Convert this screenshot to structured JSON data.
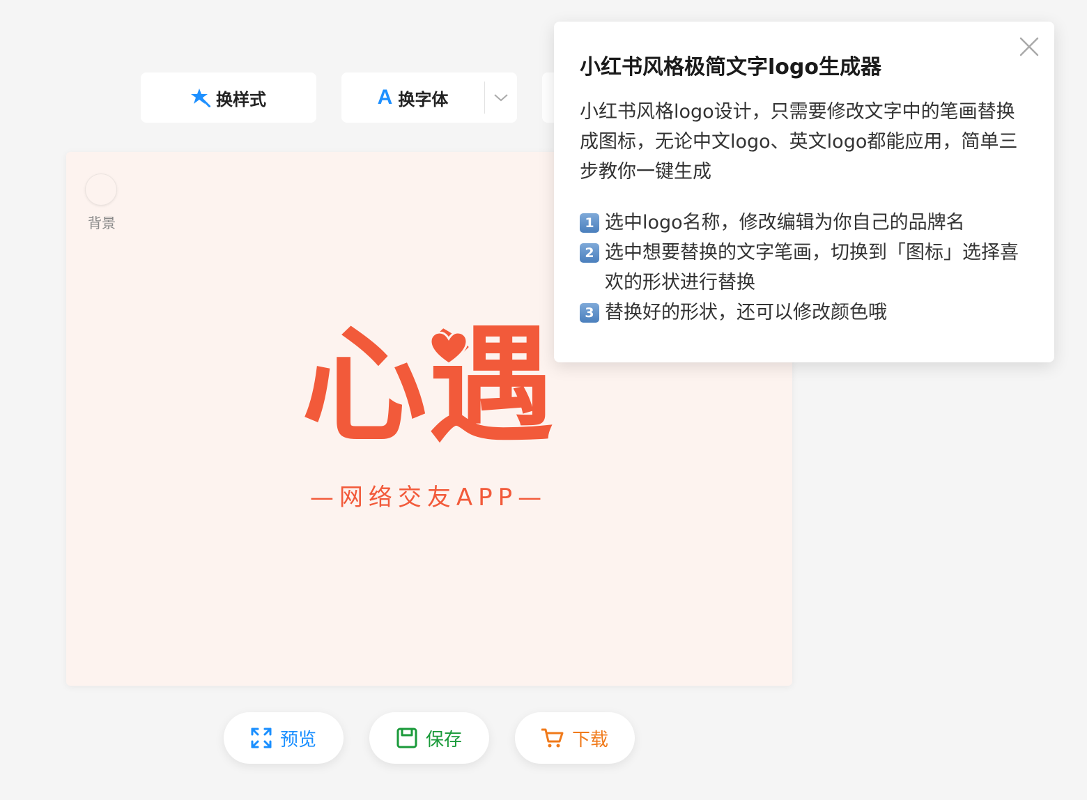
{
  "toolbar": {
    "change_style_label": "换样式",
    "change_font_letter": "A",
    "change_font_label": "换字体"
  },
  "canvas": {
    "background_label": "背景",
    "background_color": "#fdf3ef",
    "logo_title": "心遇",
    "logo_subtitle": "—网络交友APP—",
    "logo_color": "#f25a3a"
  },
  "actions": {
    "preview_label": "预览",
    "save_label": "保存",
    "download_label": "下载"
  },
  "popup": {
    "title": "小红书风格极简文字logo生成器",
    "intro": "小红书风格logo设计，只需要修改文字中的笔画替换成图标，无论中文logo、英文logo都能应用，简单三步教你一键生成",
    "steps": [
      {
        "badge": "1",
        "text": "选中logo名称，修改编辑为你自己的品牌名"
      },
      {
        "badge": "2",
        "text": "选中想要替换的文字笔画，切换到「图标」选择喜欢的形状进行替换"
      },
      {
        "badge": "3",
        "text": "替换好的形状，还可以修改颜色哦"
      }
    ]
  },
  "colors": {
    "preview": "#1a8fff",
    "save": "#1a9a3a",
    "download": "#f07a1a",
    "accent_blue": "#1e90ff"
  },
  "icons": {
    "style": "magic-star-icon",
    "font_dropdown": "chevron-down-icon",
    "preview": "expand-icon",
    "save": "floppy-disk-icon",
    "download": "shopping-cart-icon",
    "close": "close-icon",
    "heart": "heart-icon"
  }
}
